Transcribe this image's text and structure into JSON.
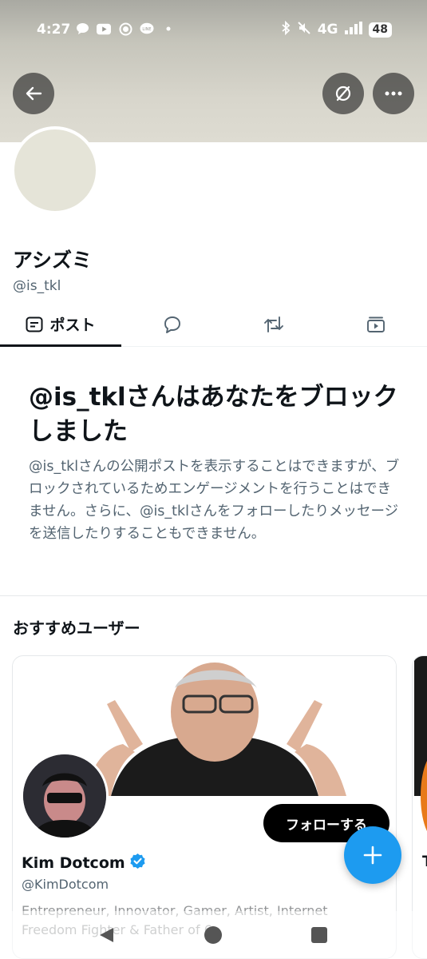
{
  "status_bar": {
    "time": "4:27",
    "network": "4G",
    "battery": "48",
    "notification_icons": [
      "chat-icon",
      "youtube-icon",
      "record-icon",
      "line-icon",
      "dot-icon"
    ],
    "system_icons": [
      "bluetooth-icon",
      "mute-icon",
      "signal-icon"
    ]
  },
  "profile": {
    "display_name": "アシズミ",
    "handle": "@is_tkl"
  },
  "tabs": [
    {
      "label": "ポスト",
      "icon": "post-icon",
      "selected": true
    },
    {
      "label": "",
      "icon": "reply-icon",
      "selected": false
    },
    {
      "label": "",
      "icon": "repost-icon",
      "selected": false
    },
    {
      "label": "",
      "icon": "media-icon",
      "selected": false
    }
  ],
  "block_notice": {
    "title": "@is_tklさんはあなたをブロックしました",
    "description": "@is_tklさんの公開ポストを表示することはできますが、ブロックされているためエンゲージメントを行うことはできません。さらに、@is_tklさんをフォローしたりメッセージを送信したりすることもできません。"
  },
  "recommended": {
    "title": "おすすめユーザー",
    "cards": [
      {
        "name": "Kim Dotcom",
        "verified": true,
        "handle": "@KimDotcom",
        "bio": "Entrepreneur, Innovator, Gamer, Artist, Internet Freedom Fighter & Father of 6",
        "follow_label": "フォローする"
      },
      {
        "name_initial": "T"
      }
    ]
  },
  "colors": {
    "accent": "#1d9bf0",
    "text_primary": "#0f1419",
    "text_secondary": "#536471",
    "banner": "#d8d6cc"
  }
}
